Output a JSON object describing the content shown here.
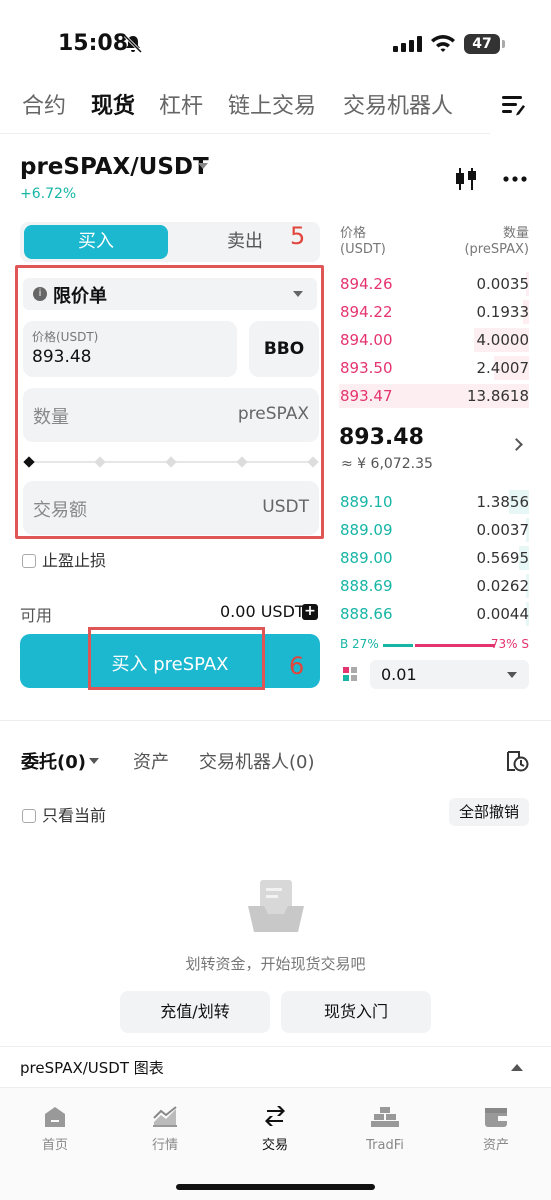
{
  "status_bar": {
    "time": "15:08",
    "battery": "47"
  },
  "top_tabs": [
    "合约",
    "现货",
    "杠杆",
    "链上交易",
    "交易机器人"
  ],
  "pair": {
    "symbol": "preSPAX/USDT",
    "change": "+6.72%"
  },
  "trade_form": {
    "buy_label": "买入",
    "sell_label": "卖出",
    "order_type": "限价单",
    "price_label": "价格(USDT)",
    "price_value": "893.48",
    "bbo_label": "BBO",
    "amount_placeholder": "数量",
    "amount_unit": "preSPAX",
    "total_placeholder": "交易额",
    "total_unit": "USDT",
    "tpsl_label": "止盈止损",
    "available_label": "可用",
    "available_value": "0.00 USDT",
    "submit_label": "买入 preSPAX"
  },
  "annotations": {
    "box5": "5",
    "box6": "6"
  },
  "order_book": {
    "price_header": "价格\n(USDT)",
    "price_header_1": "价格",
    "price_header_2": "(USDT)",
    "qty_header_1": "数量",
    "qty_header_2": "(preSPAX)",
    "asks": [
      {
        "price": "894.26",
        "qty": "0.0035"
      },
      {
        "price": "894.22",
        "qty": "0.1933"
      },
      {
        "price": "894.00",
        "qty": "4.0000"
      },
      {
        "price": "893.50",
        "qty": "2.4007"
      },
      {
        "price": "893.47",
        "qty": "13.8618"
      }
    ],
    "mid_price": "893.48",
    "mid_cny": "≈ ¥ 6,072.35",
    "bids": [
      {
        "price": "889.10",
        "qty": "1.3856"
      },
      {
        "price": "889.09",
        "qty": "0.0037"
      },
      {
        "price": "889.00",
        "qty": "0.5695"
      },
      {
        "price": "888.69",
        "qty": "0.0262"
      },
      {
        "price": "888.66",
        "qty": "0.0044"
      }
    ],
    "buy_ratio": "B 27%",
    "sell_ratio": "73% S",
    "buy_ratio_value": 27,
    "depth": "0.01"
  },
  "orders": {
    "tabs": [
      "委托(0)",
      "资产",
      "交易机器人(0)"
    ],
    "only_current": "只看当前",
    "cancel_all": "全部撤销",
    "empty_text": "划转资金，开始现货交易吧",
    "deposit_btn": "充值/划转",
    "guide_btn": "现货入门"
  },
  "chart_bar": {
    "title": "preSPAX/USDT 图表"
  },
  "bottom_nav": [
    {
      "icon": "home-icon",
      "label": "首页"
    },
    {
      "icon": "market-icon",
      "label": "行情"
    },
    {
      "icon": "trade-icon",
      "label": "交易"
    },
    {
      "icon": "tradfi-icon",
      "label": "TradFi"
    },
    {
      "icon": "wallet-icon",
      "label": "资产"
    }
  ],
  "colors": {
    "accent": "#1cb8d0",
    "ask": "#e4346f",
    "bid": "#17b5a6",
    "annotation": "#e05555"
  }
}
